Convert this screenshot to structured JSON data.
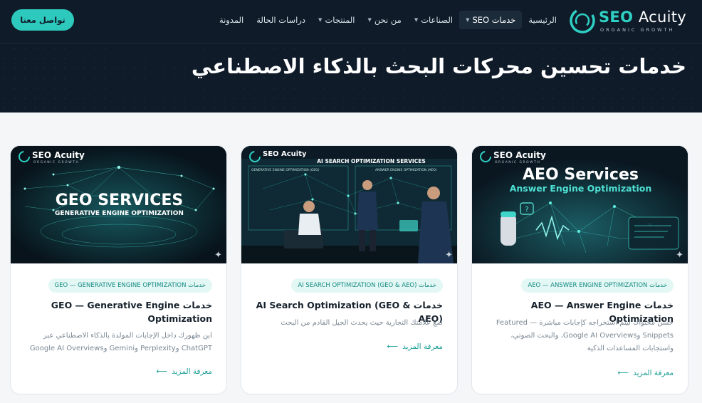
{
  "header": {
    "logo": {
      "brand": "SEO",
      "brand2": "Acuity",
      "tagline": "ORGANIC GROWTH"
    },
    "nav": [
      {
        "label": "الرئيسية",
        "has_caret": false,
        "active": false
      },
      {
        "label": "خدمات SEO",
        "has_caret": true,
        "active": true
      },
      {
        "label": "الصناعات",
        "has_caret": true,
        "active": false
      },
      {
        "label": "من نحن",
        "has_caret": true,
        "active": false
      },
      {
        "label": "المنتجات",
        "has_caret": true,
        "active": false
      },
      {
        "label": "دراسات الحالة",
        "has_caret": false,
        "active": false
      },
      {
        "label": "المدونة",
        "has_caret": false,
        "active": false
      }
    ],
    "cta_label": "تواصل معنا"
  },
  "page_title": "خدمات تحسين محركات البحث بالذكاء الاصطناعي",
  "cards": [
    {
      "image": {
        "logo": "SEO Acuity",
        "logo_sub": "ORGANIC GROWTH",
        "headline": "AEO Services",
        "subheadline": "Answer Engine Optimization"
      },
      "tag": "خدمات AEO — ANSWER ENGINE OPTIMIZATION",
      "title": "خدمات AEO — Answer Engine Optimization",
      "desc_lines": [
        "حسّن محتواك ليتم استخراجه كإجابات مباشرة — Featured",
        "Snippets وGoogle AI Overviews، والبحث الصوتي،",
        "واستجابات المساعدات الذكية"
      ],
      "more": "معرفة المزيد"
    },
    {
      "image": {
        "logo": "SEO Acuity",
        "headline": "AI SEARCH OPTIMIZATION SERVICES",
        "panel_left": "GENERATIVE ENGINE OPTIMIZATION (GEO)",
        "panel_right": "ANSWER ENGINE OPTIMIZATION (AEO)"
      },
      "tag": "خدمات AI SEARCH OPTIMIZATION (GEO & AEO)",
      "title": "خدمات AI Search Optimization (GEO & AEO)",
      "desc_lines": [
        "ضع علامتك التجارية حيث يحدث الجيل القادم من البحث"
      ],
      "more": "معرفة المزيد"
    },
    {
      "image": {
        "logo": "SEO Acuity",
        "logo_sub": "ORGANIC GROWTH",
        "headline": "GEO SERVICES",
        "subheadline": "GENERATIVE ENGINE OPTIMIZATION"
      },
      "tag": "خدمات GEO — GENERATIVE ENGINE OPTIMIZATION",
      "title": "خدمات GEO — Generative Engine Optimization",
      "desc_lines": [
        "ابن ظهورك داخل الإجابات المولدة بالذكاء الاصطناعي عبر",
        "ChatGPT وPerplexity وGemini وGoogle AI Overviews"
      ],
      "more": "معرفة المزيد"
    }
  ],
  "colors": {
    "accent": "#2ec9bd",
    "header_bg": "#0f1b29",
    "tag_bg": "#e3f7f5",
    "link": "#1a9e94"
  },
  "icons": [
    "logo-ring-icon",
    "chevron-down-icon",
    "arrow-left-icon",
    "sparkle-icon"
  ]
}
